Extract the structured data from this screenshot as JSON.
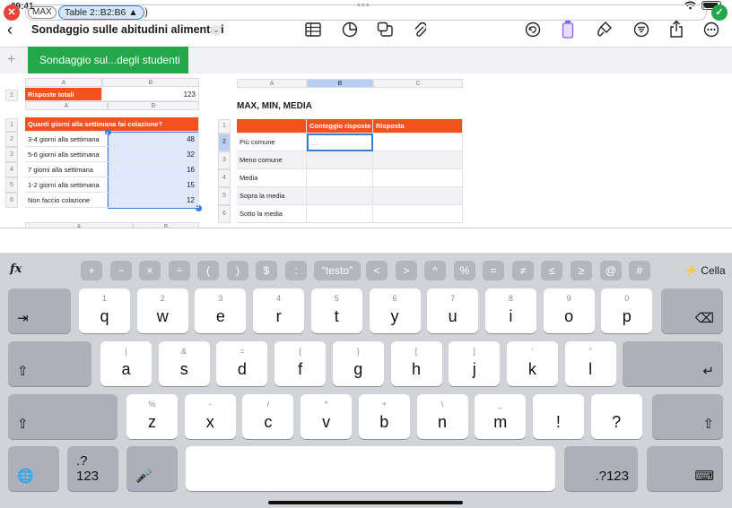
{
  "status": {
    "time": "09:41",
    "dots": "•••"
  },
  "toolbar": {
    "title": "Sondaggio sulle abitudini alimentari",
    "back_icon": "‹",
    "icons": [
      "table-icon",
      "chart-icon",
      "shapes-icon",
      "attachment-icon",
      "undo-icon",
      "format-icon",
      "brush-icon",
      "filter-icon",
      "share-icon",
      "more-icon"
    ]
  },
  "tabs": {
    "active": "Sondaggio sul...degli studenti"
  },
  "table1": {
    "cols": [
      "A",
      "B"
    ],
    "row_label": "1",
    "label": "Risposte totali",
    "value": "123"
  },
  "table2": {
    "cols": [
      "A",
      "B"
    ],
    "header": "Quanti giorni alla settimana fai colazione?",
    "rows": [
      {
        "n": "2",
        "label": "3-4 giorni alla settimana",
        "value": "48"
      },
      {
        "n": "3",
        "label": "5-6 giorni alla settimana",
        "value": "32"
      },
      {
        "n": "4",
        "label": "7 giorni alla settimana",
        "value": "16"
      },
      {
        "n": "5",
        "label": "1-2 giorni alla settimana",
        "value": "15"
      },
      {
        "n": "6",
        "label": "Non faccio colazione",
        "value": "12"
      }
    ],
    "header_row": "1"
  },
  "table3": {
    "cols": [
      "A",
      "B",
      "C"
    ],
    "title": "MAX, MIN, MEDIA",
    "col_headers": [
      "Conteggio risposte",
      "Risposta"
    ],
    "rows": [
      {
        "n": "2",
        "label": "Più comune",
        "value": "..."
      },
      {
        "n": "3",
        "label": "Meno comune",
        "value": ""
      },
      {
        "n": "4",
        "label": "Media",
        "value": ""
      },
      {
        "n": "5",
        "label": "Sopra la media",
        "value": ""
      },
      {
        "n": "6",
        "label": "Sotto la media",
        "value": ""
      }
    ],
    "header_row": "1"
  },
  "formula": {
    "func": "MAX",
    "ref": "Table 2::B2:B6 ▲",
    "cancel": "✕",
    "ok": "✓"
  },
  "keyboard": {
    "fx": "fx",
    "operators": [
      "+",
      "−",
      "×",
      "÷",
      "(",
      ")",
      "$",
      ":",
      "“testo”",
      "<",
      ">",
      "^",
      "%",
      "=",
      "≠",
      "≤",
      "≥",
      "@",
      "#"
    ],
    "cella": "⚡ Cella",
    "row1": [
      [
        "1",
        "q"
      ],
      [
        "2",
        "w"
      ],
      [
        "3",
        "e"
      ],
      [
        "4",
        "r"
      ],
      [
        "5",
        "t"
      ],
      [
        "6",
        "y"
      ],
      [
        "7",
        "u"
      ],
      [
        "8",
        "i"
      ],
      [
        "9",
        "o"
      ],
      [
        "0",
        "p"
      ]
    ],
    "row2": [
      [
        "|",
        "a"
      ],
      [
        "&",
        "s"
      ],
      [
        "=",
        "d"
      ],
      [
        "{",
        "f"
      ],
      [
        "}",
        "g"
      ],
      [
        "[",
        "h"
      ],
      [
        "]",
        "j"
      ],
      [
        "'",
        "k"
      ],
      [
        "\"",
        "l"
      ]
    ],
    "row3": [
      [
        "%",
        "z"
      ],
      [
        "-",
        "x"
      ],
      [
        "/",
        "c"
      ],
      [
        "*",
        "v"
      ],
      [
        "+",
        "b"
      ],
      [
        "\\",
        "n"
      ],
      [
        "_",
        "m"
      ],
      [
        "",
        "!"
      ],
      [
        "",
        "?"
      ]
    ],
    "numkey": ".?123",
    "tab_key": "⇥",
    "delete_key": "⌫",
    "shift_key": "⇧",
    "return_key": "↵",
    "globe_key": "🌐",
    "mic_key": "🎤",
    "hide_key": "⌨"
  },
  "colors": {
    "accent_green": "#22a84a",
    "header_orange": "#f4511e",
    "select_blue": "#3b7dd8"
  }
}
